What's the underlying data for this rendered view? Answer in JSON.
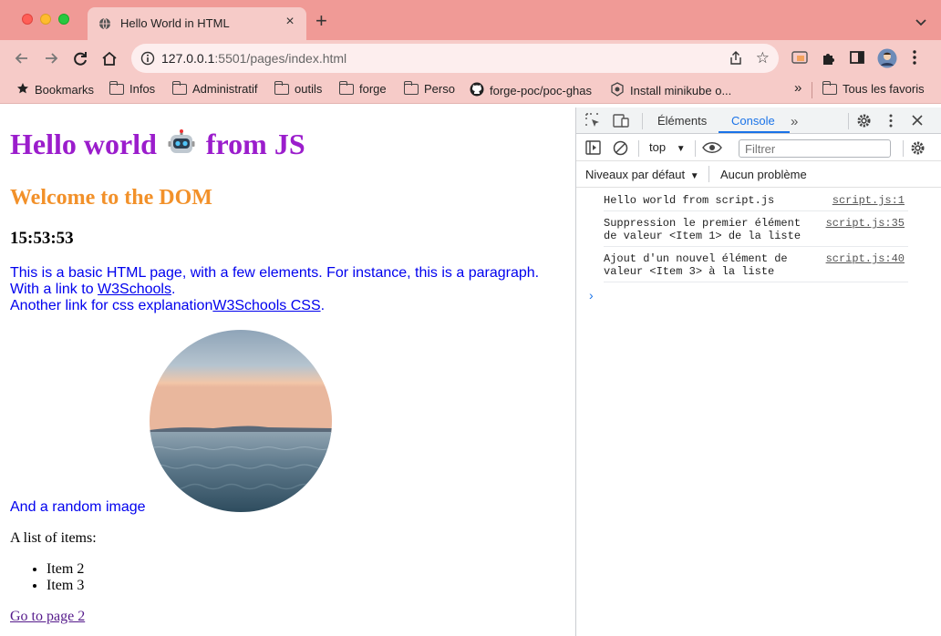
{
  "browser": {
    "tab_title": "Hello World in HTML",
    "url_host": "127.0.0.1",
    "url_rest": ":5501/pages/index.html",
    "bookmarks": [
      {
        "label": "Bookmarks",
        "icon": "star-icon"
      },
      {
        "label": "Infos",
        "icon": "folder-icon"
      },
      {
        "label": "Administratif",
        "icon": "folder-icon"
      },
      {
        "label": "outils",
        "icon": "folder-icon"
      },
      {
        "label": "forge",
        "icon": "folder-icon"
      },
      {
        "label": "Perso",
        "icon": "folder-icon"
      },
      {
        "label": "forge-poc/poc-ghas",
        "icon": "github-icon"
      },
      {
        "label": "Install minikube o...",
        "icon": "minikube-icon"
      }
    ],
    "overflow": "»",
    "all_favorites": "Tous les favoris"
  },
  "page": {
    "heading_prefix": "Hello world",
    "heading_suffix": "from JS",
    "subheading": "Welcome to the DOM",
    "clock": "15:53:53",
    "paragraph": "This is a basic HTML page, with a few elements. For instance, this is a paragraph.",
    "link_intro": "With a link to ",
    "link1": "W3Schools",
    "link1_end": ".",
    "link2_intro": "Another link for css explanation",
    "link2": "W3Schools CSS",
    "link2_end": ".",
    "image_caption": "And a random image",
    "list_label": "A list of items:",
    "items": [
      "Item 2",
      "Item 3"
    ],
    "page2_link": "Go to page 2"
  },
  "devtools": {
    "tabs": [
      "Éléments",
      "Console"
    ],
    "active_tab": "Console",
    "context": "top",
    "filter_placeholder": "Filtrer",
    "levels": "Niveaux par défaut",
    "issues": "Aucun problème",
    "messages": [
      {
        "text": "Hello world from script.js",
        "source": "script.js:1"
      },
      {
        "text": "Suppression le premier élément de valeur <Item 1> de la liste",
        "source": "script.js:35"
      },
      {
        "text": "Ajout d'un nouvel élément de valeur <Item 3> à la liste",
        "source": "script.js:40"
      }
    ],
    "prompt": "›"
  },
  "colors": {
    "heading": "#9b1dcc",
    "subheading": "#f2912a",
    "link": "#0000ee",
    "chrome": "#f09a96",
    "devtools_accent": "#1a73e8"
  }
}
